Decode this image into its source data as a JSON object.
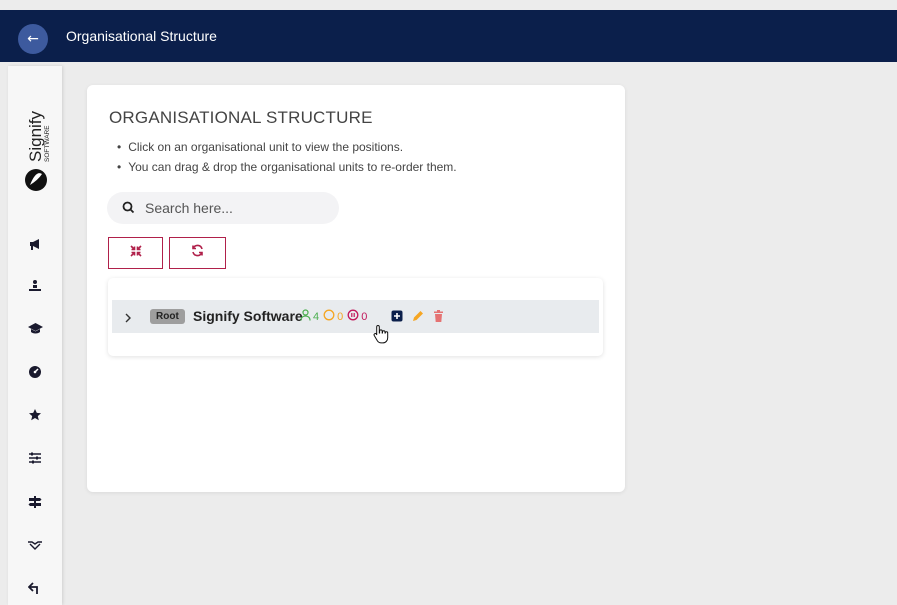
{
  "header": {
    "back_icon": "arrow-left-icon",
    "title": "Organisational Structure",
    "bar_color": "#0b1f4b"
  },
  "sidebar": {
    "logo": {
      "name": "Signify",
      "sub": "SOFTWARE"
    },
    "items": [
      {
        "icon": "megaphone-icon"
      },
      {
        "icon": "person-podium-icon"
      },
      {
        "icon": "graduation-cap-icon"
      },
      {
        "icon": "dashboard-gauge-icon"
      },
      {
        "icon": "star-icon"
      },
      {
        "icon": "sliders-icon"
      },
      {
        "icon": "signpost-icon"
      },
      {
        "icon": "handshake-icon"
      },
      {
        "icon": "user-arrow-icon"
      }
    ]
  },
  "main": {
    "title": "ORGANISATIONAL STRUCTURE",
    "instructions": [
      "Click on an organisational unit to view the positions.",
      "You can drag & drop the organisational units to re-order them."
    ],
    "search": {
      "placeholder": "Search here...",
      "value": ""
    },
    "toolbar": {
      "collapse_icon": "compress-icon",
      "refresh_icon": "refresh-icon",
      "accent": "#b0204a"
    },
    "tree": {
      "root": {
        "badge": "Root",
        "name": "Signify Software",
        "counts": {
          "people": "4",
          "vacant": "0",
          "other": "0"
        },
        "colors": {
          "people": "#4caf50",
          "vacant": "#f5a623",
          "other": "#c2185b",
          "edit": "#f5a623",
          "delete": "#e57373"
        }
      }
    }
  }
}
